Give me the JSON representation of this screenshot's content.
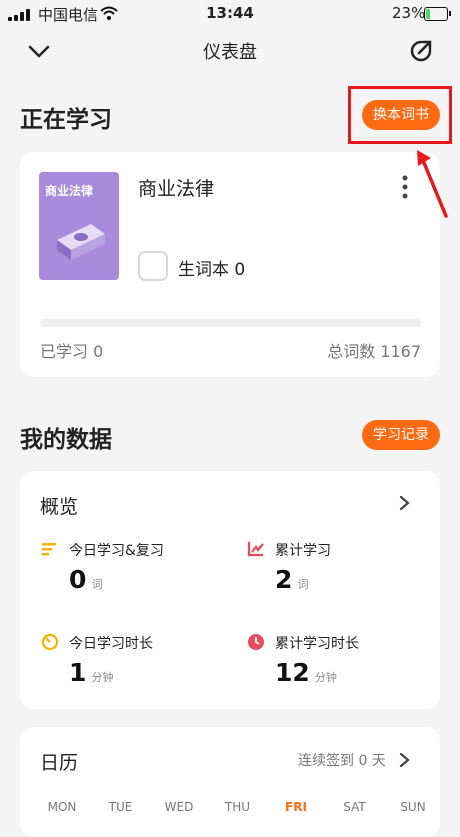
{
  "status_bar": {
    "carrier": "中国电信",
    "time": "13:44",
    "battery": "23%",
    "battery_level": 0.23
  },
  "nav": {
    "title": "仪表盘",
    "back_icon": "chevron-down-icon",
    "share_icon": "share-icon"
  },
  "studying": {
    "title": "正在学习",
    "change_book": "换本词书",
    "book": {
      "cover_title": "商业法律",
      "name": "商业法律",
      "vocab_label": "生词本 0",
      "learned": "已学习 0",
      "total": "总词数 1167",
      "progress": 0
    }
  },
  "my_data": {
    "title": "我的数据",
    "records_button": "学习记录",
    "overview": {
      "title": "概览",
      "stats": [
        {
          "label": "今日学习&复习",
          "value": "0",
          "unit": "词",
          "icon": "list-icon",
          "color": "#f5b400"
        },
        {
          "label": "累计学习",
          "value": "2",
          "unit": "词",
          "icon": "line-chart-icon",
          "color": "#e84c5a"
        },
        {
          "label": "今日学习时长",
          "value": "1",
          "unit": "分钟",
          "icon": "timer-icon",
          "color": "#f5b400"
        },
        {
          "label": "累计学习时长",
          "value": "12",
          "unit": "分钟",
          "icon": "clock-icon",
          "color": "#e84c5a"
        }
      ]
    }
  },
  "calendar": {
    "title": "日历",
    "streak": "连续签到 0 天",
    "days": [
      "MON",
      "TUE",
      "WED",
      "THU",
      "FRI",
      "SAT",
      "SUN"
    ],
    "today": "FRI"
  },
  "colors": {
    "accent": "#ff6a13",
    "annotation": "#e8191b"
  }
}
